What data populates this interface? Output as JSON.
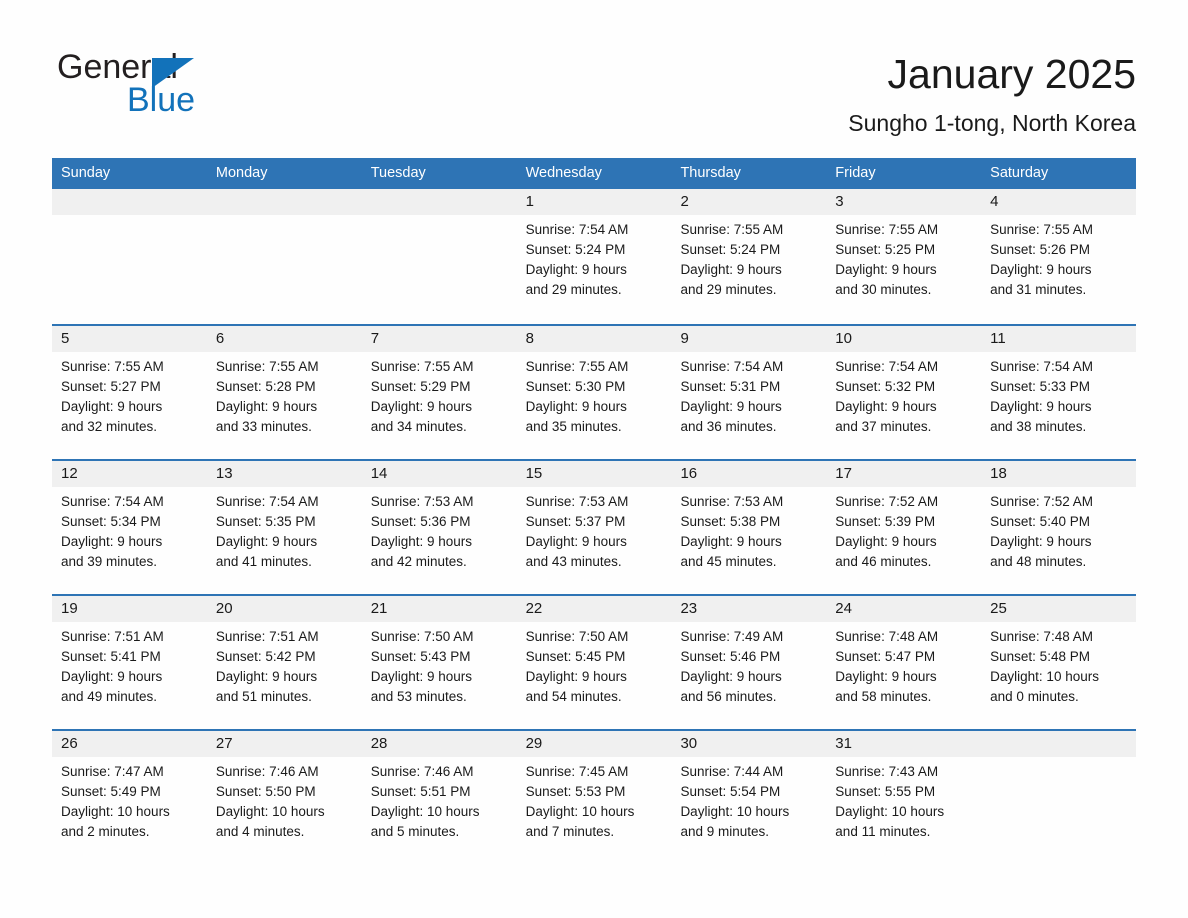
{
  "brand": {
    "name_part1": "General",
    "name_part2": "Blue",
    "triangle_icon": "triangle-icon",
    "blue": "#1272BA"
  },
  "header": {
    "title": "January 2025",
    "subtitle": "Sungho 1-tong, North Korea",
    "header_bg": "#2E74B5",
    "band_bg": "#F0F0F0"
  },
  "weekdays": [
    "Sunday",
    "Monday",
    "Tuesday",
    "Wednesday",
    "Thursday",
    "Friday",
    "Saturday"
  ],
  "weeks": [
    [
      {
        "day": "",
        "sunrise": "",
        "sunset": "",
        "daylight_line1": "",
        "daylight_line2": ""
      },
      {
        "day": "",
        "sunrise": "",
        "sunset": "",
        "daylight_line1": "",
        "daylight_line2": ""
      },
      {
        "day": "",
        "sunrise": "",
        "sunset": "",
        "daylight_line1": "",
        "daylight_line2": ""
      },
      {
        "day": "1",
        "sunrise": "Sunrise: 7:54 AM",
        "sunset": "Sunset: 5:24 PM",
        "daylight_line1": "Daylight: 9 hours",
        "daylight_line2": "and 29 minutes."
      },
      {
        "day": "2",
        "sunrise": "Sunrise: 7:55 AM",
        "sunset": "Sunset: 5:24 PM",
        "daylight_line1": "Daylight: 9 hours",
        "daylight_line2": "and 29 minutes."
      },
      {
        "day": "3",
        "sunrise": "Sunrise: 7:55 AM",
        "sunset": "Sunset: 5:25 PM",
        "daylight_line1": "Daylight: 9 hours",
        "daylight_line2": "and 30 minutes."
      },
      {
        "day": "4",
        "sunrise": "Sunrise: 7:55 AM",
        "sunset": "Sunset: 5:26 PM",
        "daylight_line1": "Daylight: 9 hours",
        "daylight_line2": "and 31 minutes."
      }
    ],
    [
      {
        "day": "5",
        "sunrise": "Sunrise: 7:55 AM",
        "sunset": "Sunset: 5:27 PM",
        "daylight_line1": "Daylight: 9 hours",
        "daylight_line2": "and 32 minutes."
      },
      {
        "day": "6",
        "sunrise": "Sunrise: 7:55 AM",
        "sunset": "Sunset: 5:28 PM",
        "daylight_line1": "Daylight: 9 hours",
        "daylight_line2": "and 33 minutes."
      },
      {
        "day": "7",
        "sunrise": "Sunrise: 7:55 AM",
        "sunset": "Sunset: 5:29 PM",
        "daylight_line1": "Daylight: 9 hours",
        "daylight_line2": "and 34 minutes."
      },
      {
        "day": "8",
        "sunrise": "Sunrise: 7:55 AM",
        "sunset": "Sunset: 5:30 PM",
        "daylight_line1": "Daylight: 9 hours",
        "daylight_line2": "and 35 minutes."
      },
      {
        "day": "9",
        "sunrise": "Sunrise: 7:54 AM",
        "sunset": "Sunset: 5:31 PM",
        "daylight_line1": "Daylight: 9 hours",
        "daylight_line2": "and 36 minutes."
      },
      {
        "day": "10",
        "sunrise": "Sunrise: 7:54 AM",
        "sunset": "Sunset: 5:32 PM",
        "daylight_line1": "Daylight: 9 hours",
        "daylight_line2": "and 37 minutes."
      },
      {
        "day": "11",
        "sunrise": "Sunrise: 7:54 AM",
        "sunset": "Sunset: 5:33 PM",
        "daylight_line1": "Daylight: 9 hours",
        "daylight_line2": "and 38 minutes."
      }
    ],
    [
      {
        "day": "12",
        "sunrise": "Sunrise: 7:54 AM",
        "sunset": "Sunset: 5:34 PM",
        "daylight_line1": "Daylight: 9 hours",
        "daylight_line2": "and 39 minutes."
      },
      {
        "day": "13",
        "sunrise": "Sunrise: 7:54 AM",
        "sunset": "Sunset: 5:35 PM",
        "daylight_line1": "Daylight: 9 hours",
        "daylight_line2": "and 41 minutes."
      },
      {
        "day": "14",
        "sunrise": "Sunrise: 7:53 AM",
        "sunset": "Sunset: 5:36 PM",
        "daylight_line1": "Daylight: 9 hours",
        "daylight_line2": "and 42 minutes."
      },
      {
        "day": "15",
        "sunrise": "Sunrise: 7:53 AM",
        "sunset": "Sunset: 5:37 PM",
        "daylight_line1": "Daylight: 9 hours",
        "daylight_line2": "and 43 minutes."
      },
      {
        "day": "16",
        "sunrise": "Sunrise: 7:53 AM",
        "sunset": "Sunset: 5:38 PM",
        "daylight_line1": "Daylight: 9 hours",
        "daylight_line2": "and 45 minutes."
      },
      {
        "day": "17",
        "sunrise": "Sunrise: 7:52 AM",
        "sunset": "Sunset: 5:39 PM",
        "daylight_line1": "Daylight: 9 hours",
        "daylight_line2": "and 46 minutes."
      },
      {
        "day": "18",
        "sunrise": "Sunrise: 7:52 AM",
        "sunset": "Sunset: 5:40 PM",
        "daylight_line1": "Daylight: 9 hours",
        "daylight_line2": "and 48 minutes."
      }
    ],
    [
      {
        "day": "19",
        "sunrise": "Sunrise: 7:51 AM",
        "sunset": "Sunset: 5:41 PM",
        "daylight_line1": "Daylight: 9 hours",
        "daylight_line2": "and 49 minutes."
      },
      {
        "day": "20",
        "sunrise": "Sunrise: 7:51 AM",
        "sunset": "Sunset: 5:42 PM",
        "daylight_line1": "Daylight: 9 hours",
        "daylight_line2": "and 51 minutes."
      },
      {
        "day": "21",
        "sunrise": "Sunrise: 7:50 AM",
        "sunset": "Sunset: 5:43 PM",
        "daylight_line1": "Daylight: 9 hours",
        "daylight_line2": "and 53 minutes."
      },
      {
        "day": "22",
        "sunrise": "Sunrise: 7:50 AM",
        "sunset": "Sunset: 5:45 PM",
        "daylight_line1": "Daylight: 9 hours",
        "daylight_line2": "and 54 minutes."
      },
      {
        "day": "23",
        "sunrise": "Sunrise: 7:49 AM",
        "sunset": "Sunset: 5:46 PM",
        "daylight_line1": "Daylight: 9 hours",
        "daylight_line2": "and 56 minutes."
      },
      {
        "day": "24",
        "sunrise": "Sunrise: 7:48 AM",
        "sunset": "Sunset: 5:47 PM",
        "daylight_line1": "Daylight: 9 hours",
        "daylight_line2": "and 58 minutes."
      },
      {
        "day": "25",
        "sunrise": "Sunrise: 7:48 AM",
        "sunset": "Sunset: 5:48 PM",
        "daylight_line1": "Daylight: 10 hours",
        "daylight_line2": "and 0 minutes."
      }
    ],
    [
      {
        "day": "26",
        "sunrise": "Sunrise: 7:47 AM",
        "sunset": "Sunset: 5:49 PM",
        "daylight_line1": "Daylight: 10 hours",
        "daylight_line2": "and 2 minutes."
      },
      {
        "day": "27",
        "sunrise": "Sunrise: 7:46 AM",
        "sunset": "Sunset: 5:50 PM",
        "daylight_line1": "Daylight: 10 hours",
        "daylight_line2": "and 4 minutes."
      },
      {
        "day": "28",
        "sunrise": "Sunrise: 7:46 AM",
        "sunset": "Sunset: 5:51 PM",
        "daylight_line1": "Daylight: 10 hours",
        "daylight_line2": "and 5 minutes."
      },
      {
        "day": "29",
        "sunrise": "Sunrise: 7:45 AM",
        "sunset": "Sunset: 5:53 PM",
        "daylight_line1": "Daylight: 10 hours",
        "daylight_line2": "and 7 minutes."
      },
      {
        "day": "30",
        "sunrise": "Sunrise: 7:44 AM",
        "sunset": "Sunset: 5:54 PM",
        "daylight_line1": "Daylight: 10 hours",
        "daylight_line2": "and 9 minutes."
      },
      {
        "day": "31",
        "sunrise": "Sunrise: 7:43 AM",
        "sunset": "Sunset: 5:55 PM",
        "daylight_line1": "Daylight: 10 hours",
        "daylight_line2": "and 11 minutes."
      },
      {
        "day": "",
        "sunrise": "",
        "sunset": "",
        "daylight_line1": "",
        "daylight_line2": ""
      }
    ]
  ]
}
